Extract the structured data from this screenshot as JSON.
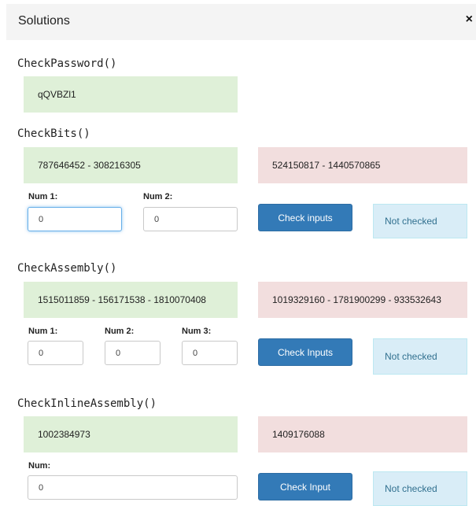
{
  "header": {
    "title": "Solutions",
    "close_label": "×"
  },
  "check_password": {
    "title": "CheckPassword()",
    "value": "qQVBZl1"
  },
  "check_bits": {
    "title": "CheckBits()",
    "correct": "787646452 - 308216305",
    "incorrect": "524150817 - 1440570865",
    "num1_label": "Num 1:",
    "num2_label": "Num 2:",
    "num1_value": "0",
    "num2_value": "0",
    "button_label": "Check inputs",
    "status": "Not checked"
  },
  "check_assembly": {
    "title": "CheckAssembly()",
    "correct": "1515011859 - 156171538 - 1810070408",
    "incorrect": "1019329160 - 1781900299 - 933532643",
    "num1_label": "Num 1:",
    "num2_label": "Num 2:",
    "num3_label": "Num 3:",
    "num1_value": "0",
    "num2_value": "0",
    "num3_value": "0",
    "button_label": "Check Inputs",
    "status": "Not checked"
  },
  "check_inline_assembly": {
    "title": "CheckInlineAssembly()",
    "correct": "1002384973",
    "incorrect": "1409176088",
    "num_label": "Num:",
    "num_value": "0",
    "button_label": "Check Input",
    "status": "Not checked"
  },
  "colors": {
    "success_bg": "#dff0d8",
    "danger_bg": "#f2dede",
    "info_bg": "#d9edf7",
    "primary": "#337ab7"
  }
}
